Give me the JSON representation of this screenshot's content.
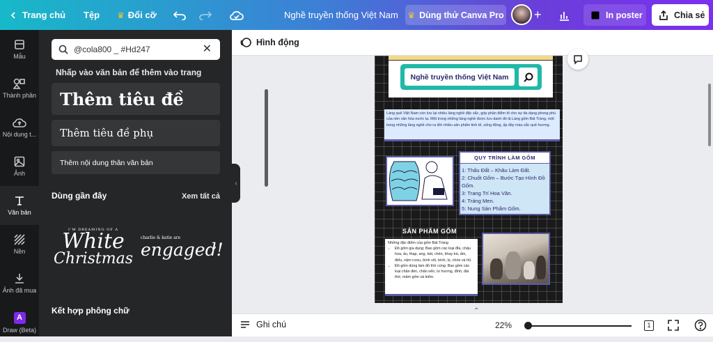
{
  "topbar": {
    "home": "Trang chủ",
    "file": "Tệp",
    "resize": "Đổi cỡ",
    "title": "Nghề truyền thống Việt Nam",
    "try_pro": "Dùng thử Canva Pro",
    "print": "In poster",
    "share": "Chia sẻ"
  },
  "rail": {
    "templates": "Mẫu",
    "elements": "Thành phần",
    "uploads": "Nội dung t...",
    "photos": "Ảnh",
    "text": "Văn bản",
    "background": "Nền",
    "purchased": "Ảnh đã mua",
    "draw": "Draw (Beta)"
  },
  "panel": {
    "search_value": "@cola800 _ #Hd247",
    "hint": "Nhấp vào văn bản để thêm vào trang",
    "heading": "Thêm tiêu đề",
    "subheading": "Thêm tiêu đề phụ",
    "body": "Thêm nội dung thân văn bản",
    "recent_title": "Dùng gần đây",
    "see_all": "Xem tất cả",
    "recent1_small": "I'M DREAMING OF A",
    "recent1_big1": "White",
    "recent1_big2": "Christmas",
    "recent2_small": "charlie & katie are",
    "recent2_big": "engaged!",
    "combo_title": "Kết hợp phông chữ"
  },
  "toolbar": {
    "animate": "Hình động"
  },
  "bottombar": {
    "notes": "Ghi chú",
    "zoom": "22%",
    "page": "1"
  },
  "canvas": {
    "search_title": "Nghề truyền thống Việt Nam",
    "intro": "Làng quê Việt Nam còn lưu lại nhiều làng nghề đặc sắc, góp phần điểm tô cho sự đa dạng phong phú của nền văn hóa nước ta. Một trong những làng nghề được lưu danh đó là Làng gốm Bát Tràng, một trong những làng nghề cho ra đời nhiều sản phẩm tinh tế, sống động, ấp đầy màu sắc quê hương.",
    "process_title": "QUY TRÌNH LÀM GỐM",
    "process_steps": [
      "1: Thấu Đất – Khâu Làm Đất.",
      "2: Chuốt Gốm – Bước Tạo Hình Đồ Gốm.",
      "3: Trang Trí Hoa Văn.",
      "4: Tráng Men.",
      "5: Nung Sản Phẩm Gốm."
    ],
    "products_title": "SẢN PHẨM GỐM",
    "products_intro": "Những đặc điểm của gốm Bát Tràng",
    "products_items": [
      "Đồ gốm gia dụng: Bao gồm các loại đĩa, chậu hoa, ấu, thạp, ang, bát, chén, khay trà, ấm, điếu, nậm rượu, bình vôi, bình, lọ, chóe và hũ.",
      "Đồ gốm dùng làm đồ thờ cúng: Bao gồm các loại chân đèn, chân nến, lư hương, đỉnh, đài thờ, mâm gốm và kiếm."
    ]
  },
  "colors": {
    "accent_teal": "#17b9c9",
    "accent_purple": "#7b2ff0",
    "panel_bg": "#252627",
    "rail_bg": "#18191b"
  }
}
